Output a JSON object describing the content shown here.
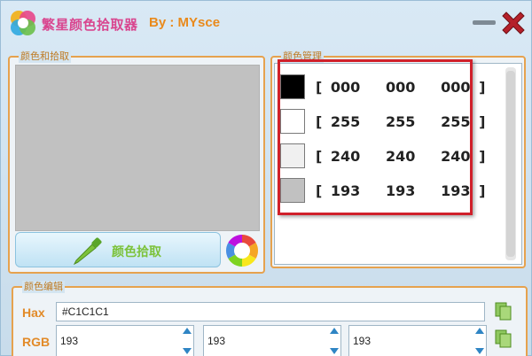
{
  "titlebar": {
    "app_title": "繁星颜色拾取器",
    "author": "By : MYsce"
  },
  "picker": {
    "group_title": "颜色和拾取",
    "preview_color": "#C1C1C1",
    "pick_label": "颜色拾取"
  },
  "manage": {
    "group_title": "颜色管理",
    "swatches": [
      {
        "color": "#000000",
        "text": "[ 000   000   000 ]"
      },
      {
        "color": "#FFFFFF",
        "text": "[ 255   255   255 ]"
      },
      {
        "color": "#F0F0F0",
        "text": "[ 240   240   240 ]"
      },
      {
        "color": "#C1C1C1",
        "text": "[ 193   193   193 ]"
      }
    ]
  },
  "edit": {
    "group_title": "颜色编辑",
    "hax_label": "Hax",
    "rgb_label": "RGB",
    "hex_value": "#C1C1C1",
    "r": "193",
    "g": "193",
    "b": "193"
  },
  "colors": {
    "accent_orange": "#E6A24E",
    "highlight_red": "#D0202A",
    "title_pink": "#D9468F"
  },
  "icons": [
    "logo-icon",
    "minimize-icon",
    "close-icon",
    "pen-icon",
    "color-wheel-icon",
    "copy-icon"
  ]
}
